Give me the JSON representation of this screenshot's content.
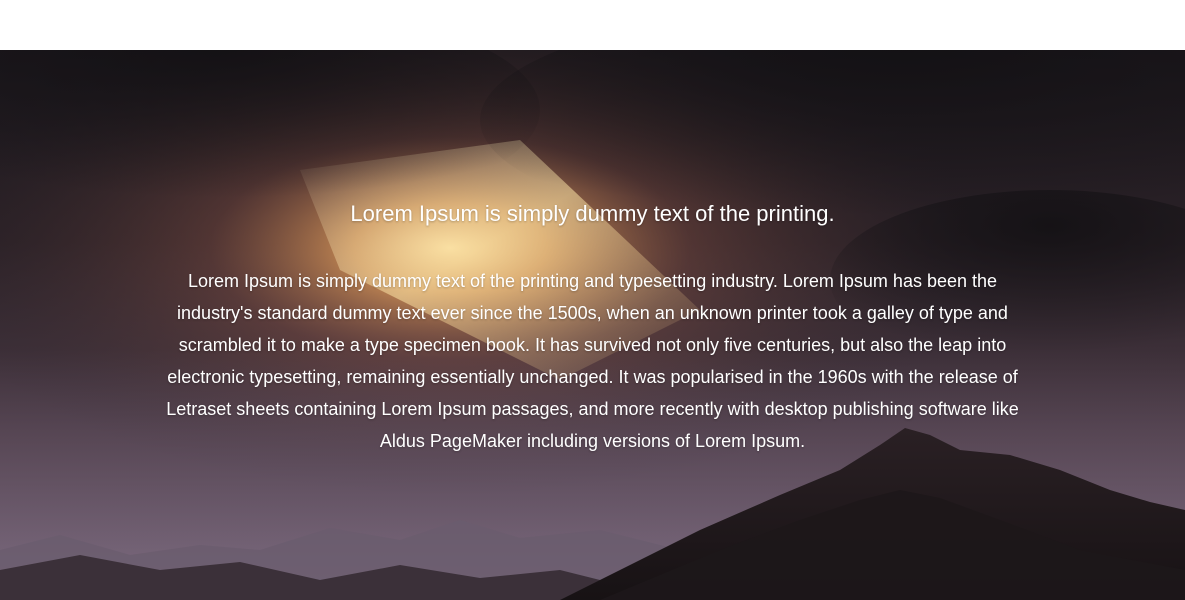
{
  "hero": {
    "title": "Lorem Ipsum is simply dummy text of the printing.",
    "body": "Lorem Ipsum is simply dummy text of the printing and typesetting industry. Lorem Ipsum has been the industry's standard dummy text ever since the 1500s, when an unknown printer took a galley of type and scrambled it to make a type specimen book. It has survived not only five centuries, but also the leap into electronic typesetting, remaining essentially unchanged. It was popularised in the 1960s with the release of Letraset sheets containing Lorem Ipsum passages, and more recently with desktop publishing software like Aldus PageMaker including versions of Lorem Ipsum.",
    "text_color": "#ffffff"
  },
  "colors": {
    "page_background": "#ffffff",
    "sky_dark": "#1e1a1f",
    "sun_glow": "#ffd27a",
    "mountain_dark": "#1d1719"
  }
}
